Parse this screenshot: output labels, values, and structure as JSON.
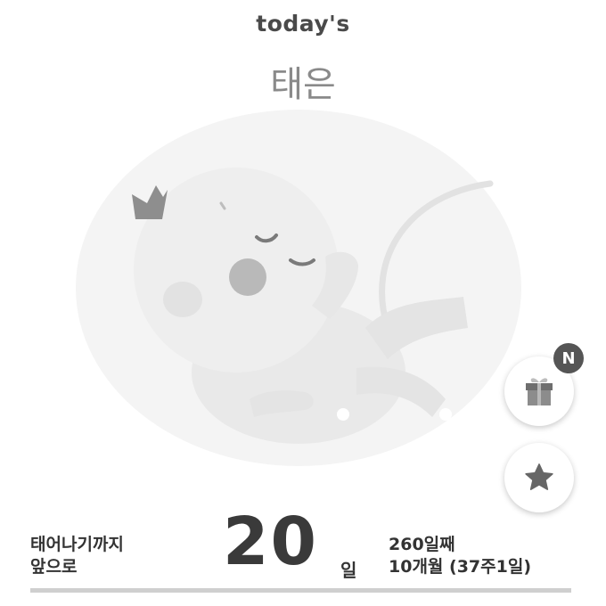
{
  "header": {
    "title": "today's"
  },
  "baby": {
    "name": "태은"
  },
  "actions": {
    "gift_icon": "gift-icon",
    "gift_badge": "N",
    "star_icon": "star-icon"
  },
  "countdown": {
    "label_line1": "태어나기까지",
    "label_line2": "앞으로",
    "days": "20",
    "unit": "일"
  },
  "progress": {
    "day_count": "260일째",
    "month_week": "10개월 (37주1일)"
  },
  "colors": {
    "text_dark": "#333333",
    "badge": "#555555",
    "divider": "#cfcfcf"
  }
}
